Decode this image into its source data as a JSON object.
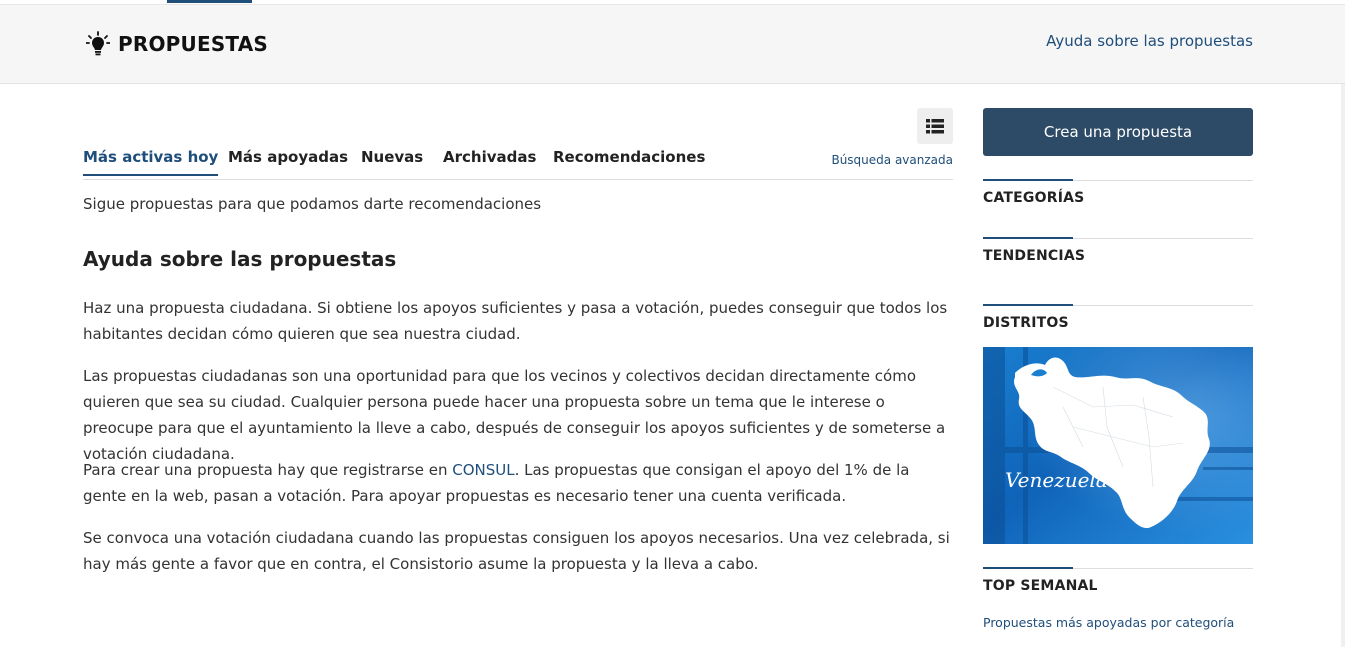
{
  "header": {
    "title": "PROPUESTAS",
    "help_link": "Ayuda sobre las propuestas"
  },
  "tabs": [
    {
      "label": "Más activas hoy",
      "active": true
    },
    {
      "label": "Más apoyadas",
      "active": false
    },
    {
      "label": "Nuevas",
      "active": false
    },
    {
      "label": "Archivadas",
      "active": false
    },
    {
      "label": "Recomendaciones",
      "active": false
    }
  ],
  "advanced_search": "Búsqueda avanzada",
  "follow_text": "Sigue propuestas para que podamos darte recomendaciones",
  "help": {
    "title": "Ayuda sobre las propuestas",
    "p1": "Haz una propuesta ciudadana. Si obtiene los apoyos suficientes y pasa a votación, puedes conseguir que todos los habitantes decidan cómo quieren que sea nuestra ciudad.",
    "p2": "Las propuestas ciudadanas son una oportunidad para que los vecinos y colectivos decidan directamente cómo quieren que sea su ciudad. Cualquier persona puede hacer una propuesta sobre un tema que le interese o preocupe para que el ayuntamiento la lleve a cabo, después de conseguir los apoyos suficientes y de someterse a votación ciudadana.",
    "p3_before": "Para crear una propuesta hay que registrarse en ",
    "p3_link": "CONSUL",
    "p3_after": ". Las propuestas que consigan el apoyo del 1% de la gente en la web, pasan a votación. Para apoyar propuestas es necesario tener una cuenta verificada.",
    "p4": "Se convoca una votación ciudadana cuando las propuestas consiguen los apoyos necesarios. Una vez celebrada, si hay más gente a favor que en contra, el Consistorio asume la propuesta y la lleva a cabo."
  },
  "sidebar": {
    "create_button": "Crea una propuesta",
    "categories": "CATEGORÍAS",
    "trends": "TENDENCIAS",
    "districts": "DISTRITOS",
    "map_label": "Venezuela",
    "top_weekly": "TOP SEMANAL",
    "top_weekly_link": "Propuestas más apoyadas por categoría"
  },
  "colors": {
    "accent": "#1f4e7a",
    "button": "#2d4a66",
    "header_bg": "#f6f6f6"
  }
}
